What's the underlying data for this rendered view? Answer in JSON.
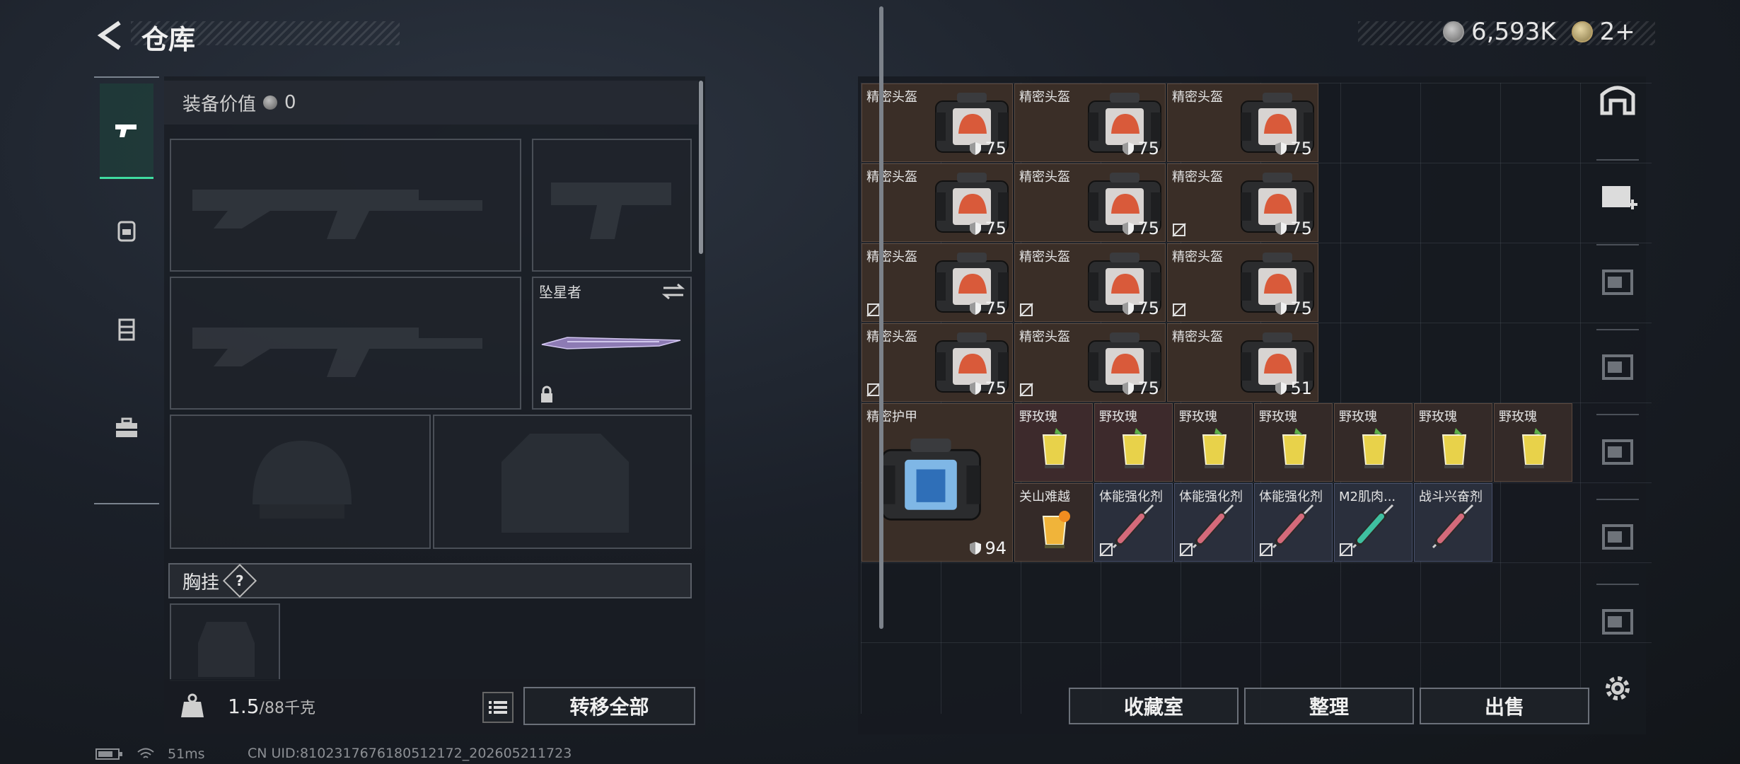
{
  "header": {
    "title": "仓库",
    "currency_amount": "6,593K",
    "secondary_amount": "2+"
  },
  "left_nav": {
    "items": [
      "weapon",
      "backpack",
      "vest",
      "toolbox"
    ],
    "active": "weapon"
  },
  "loadout": {
    "equip_value_label": "装备价值",
    "equip_value": "0",
    "melee_name": "坠星者",
    "chest_label": "胸挂",
    "help_symbol": "?"
  },
  "weight": {
    "current": "1.5",
    "max": "/88千克"
  },
  "buttons": {
    "transfer_all": "转移全部",
    "collection": "收藏室",
    "organize": "整理",
    "sell": "出售"
  },
  "grid": {
    "helmets": [
      {
        "label": "精密头盔",
        "durability": "75",
        "untradable": false
      },
      {
        "label": "精密头盔",
        "durability": "75",
        "untradable": false
      },
      {
        "label": "精密头盔",
        "durability": "75",
        "untradable": false
      },
      {
        "label": "精密头盔",
        "durability": "75",
        "untradable": false
      },
      {
        "label": "精密头盔",
        "durability": "75",
        "untradable": false
      },
      {
        "label": "精密头盔",
        "durability": "75",
        "untradable": true
      },
      {
        "label": "精密头盔",
        "durability": "75",
        "untradable": true
      },
      {
        "label": "精密头盔",
        "durability": "75",
        "untradable": true
      },
      {
        "label": "精密头盔",
        "durability": "75",
        "untradable": true
      },
      {
        "label": "精密头盔",
        "durability": "75",
        "untradable": true
      },
      {
        "label": "精密头盔",
        "durability": "75",
        "untradable": true
      },
      {
        "label": "精密头盔",
        "durability": "51",
        "untradable": false
      }
    ],
    "armor": {
      "label": "精密护甲",
      "durability": "94"
    },
    "drinks": [
      "野玫瑰",
      "野玫瑰",
      "野玫瑰",
      "野玫瑰",
      "野玫瑰",
      "野玫瑰",
      "野玫瑰"
    ],
    "consumables": [
      {
        "label": "关山难越",
        "kind": "drink",
        "untradable": false
      },
      {
        "label": "体能强化剂",
        "kind": "syringe-red",
        "untradable": true
      },
      {
        "label": "体能强化剂",
        "kind": "syringe-red",
        "untradable": true
      },
      {
        "label": "体能强化剂",
        "kind": "syringe-red",
        "untradable": true
      },
      {
        "label": "M2肌肉...",
        "kind": "syringe-green",
        "untradable": true
      },
      {
        "label": "战斗兴奋剂",
        "kind": "syringe-red",
        "untradable": false
      }
    ]
  },
  "right_rail": {
    "icons": [
      "safehouse-icon",
      "add-container-icon",
      "container-iv-icon",
      "container-iv-a-icon",
      "container-iii-icon",
      "container-iv-a-icon-2",
      "container-iv-icon-2"
    ]
  },
  "status_bar": {
    "ping": "51ms",
    "uid": "CN UID:810231767618051217​2_202605211723"
  },
  "colors": {
    "accent": "#3fdca0",
    "cell_brown": "#3a2e27",
    "cell_syringe": "#2a2f3c"
  }
}
